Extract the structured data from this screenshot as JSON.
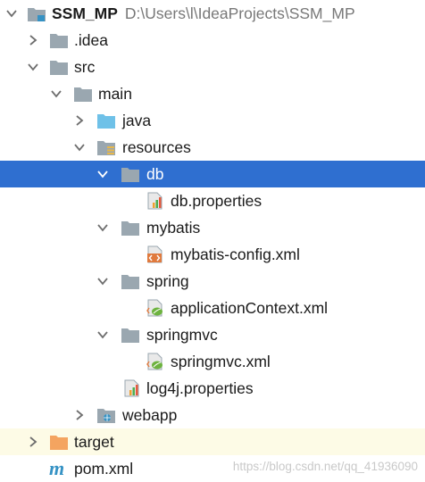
{
  "project": {
    "name": "SSM_MP",
    "path": "D:\\Users\\l\\IdeaProjects\\SSM_MP"
  },
  "nodes": [
    {
      "label": "SSM_MP",
      "state": "expanded",
      "icon": "project-module-icon"
    },
    {
      "label": ".idea",
      "state": "collapsed",
      "icon": "folder-icon"
    },
    {
      "label": "src",
      "state": "expanded",
      "icon": "folder-icon"
    },
    {
      "label": "main",
      "state": "expanded",
      "icon": "folder-icon"
    },
    {
      "label": "java",
      "state": "collapsed",
      "icon": "source-folder-icon"
    },
    {
      "label": "resources",
      "state": "expanded",
      "icon": "resources-folder-icon"
    },
    {
      "label": "db",
      "state": "expanded",
      "icon": "folder-icon",
      "selected": true
    },
    {
      "label": "db.properties",
      "state": "leaf",
      "icon": "properties-file-icon"
    },
    {
      "label": "mybatis",
      "state": "expanded",
      "icon": "folder-icon"
    },
    {
      "label": "mybatis-config.xml",
      "state": "leaf",
      "icon": "xml-file-icon"
    },
    {
      "label": "spring",
      "state": "expanded",
      "icon": "folder-icon"
    },
    {
      "label": "applicationContext.xml",
      "state": "leaf",
      "icon": "spring-xml-file-icon"
    },
    {
      "label": "springmvc",
      "state": "expanded",
      "icon": "folder-icon"
    },
    {
      "label": "springmvc.xml",
      "state": "leaf",
      "icon": "spring-xml-file-icon"
    },
    {
      "label": "log4j.properties",
      "state": "leaf",
      "icon": "properties-file-icon"
    },
    {
      "label": "webapp",
      "state": "collapsed",
      "icon": "web-folder-icon"
    },
    {
      "label": "target",
      "state": "collapsed",
      "icon": "excluded-folder-icon"
    },
    {
      "label": "pom.xml",
      "state": "leaf",
      "icon": "maven-pom-icon"
    }
  ],
  "watermark": "https://blog.csdn.net/qq_41936090",
  "colors": {
    "selection": "#2f6fd0",
    "excluded_row": "#fdfbe6",
    "folder": "#9aa7b0",
    "source_folder": "#6fc1e8",
    "excluded_folder": "#f4a460"
  }
}
